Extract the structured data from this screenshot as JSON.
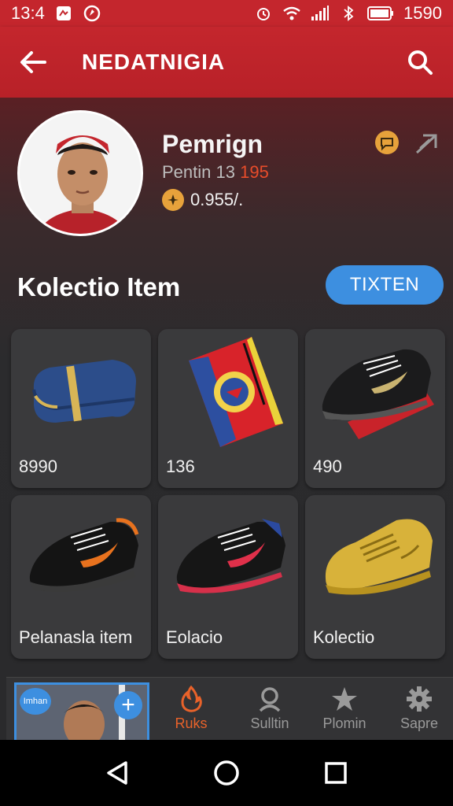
{
  "status_bar": {
    "time": "13:4",
    "clock_text": "1590"
  },
  "app_bar": {
    "title": "NEDATNIGIA"
  },
  "profile": {
    "name": "Pemrign",
    "sub_prefix": "Pentin",
    "sub_value": "13",
    "sub_accent": "195",
    "coins": "0.955/."
  },
  "collection": {
    "title": "Kolectio Item",
    "button_label": "TIXTEN",
    "items": [
      {
        "label": "8990",
        "icon": "folded-denim-item"
      },
      {
        "label": "136",
        "icon": "pennant-flag-item"
      },
      {
        "label": "490",
        "icon": "black-sneaker-item"
      },
      {
        "label": "Pelanasla item",
        "icon": "black-orange-sneaker-item"
      },
      {
        "label": "Eolacio",
        "icon": "black-red-sneaker-item"
      },
      {
        "label": "Kolectio",
        "icon": "yellow-sneaker-item"
      }
    ]
  },
  "bottom_nav": {
    "story_badge": "Imhan",
    "story_add": "+",
    "items": [
      {
        "label": "Ruks",
        "icon": "flame-icon",
        "active": true
      },
      {
        "label": "Sulltin",
        "icon": "user-icon",
        "active": false
      },
      {
        "label": "Plomin",
        "icon": "star-icon",
        "active": false
      },
      {
        "label": "Sapre",
        "icon": "gear-icon",
        "active": false
      }
    ]
  },
  "colors": {
    "brand_red": "#c4262d",
    "accent_blue": "#3d8fe0",
    "accent_orange": "#e8622a",
    "card_bg": "#3a3a3c"
  }
}
